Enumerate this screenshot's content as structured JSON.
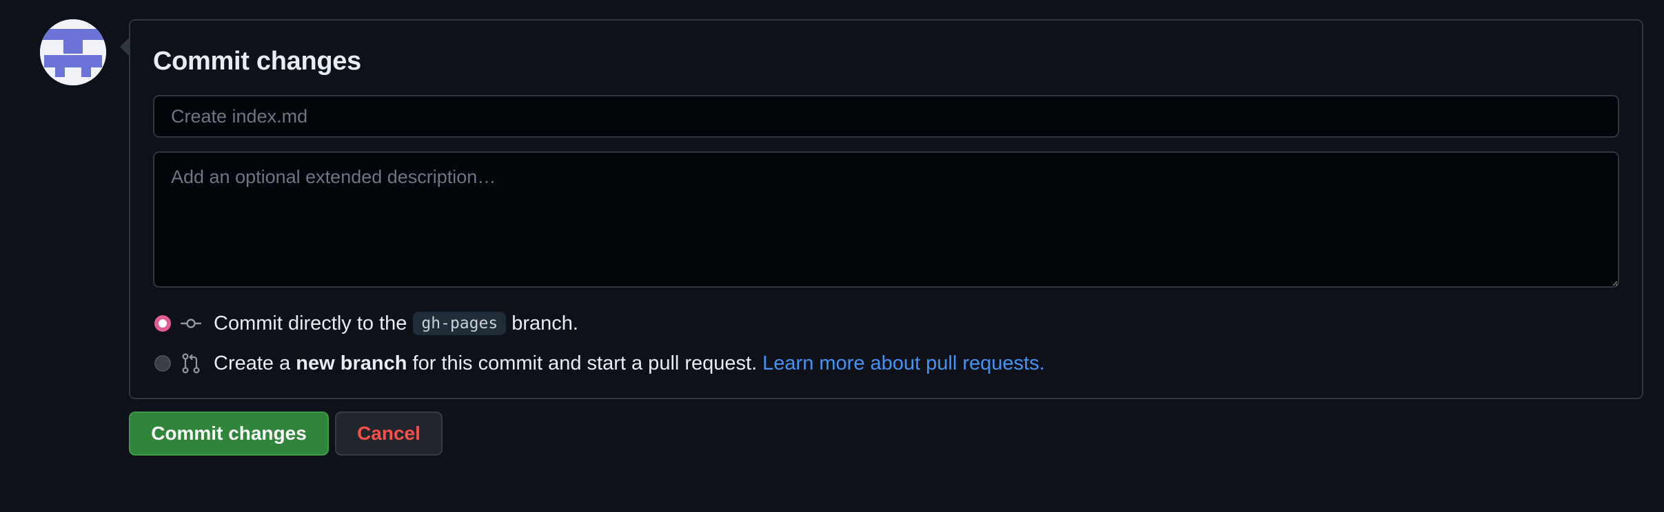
{
  "commit_form": {
    "title": "Commit changes",
    "summary_placeholder": "Create index.md",
    "description_placeholder": "Add an optional extended description…",
    "options": [
      {
        "checked": true,
        "icon": "git-commit-icon",
        "text_before": "Commit directly to the",
        "branch": "gh-pages",
        "text_after": "branch."
      },
      {
        "checked": false,
        "icon": "git-pull-request-icon",
        "text_before": "Create a",
        "bold_text": "new branch",
        "text_after": "for this commit and start a pull request.",
        "link_text": "Learn more about pull requests."
      }
    ]
  },
  "actions": {
    "commit_label": "Commit changes",
    "cancel_label": "Cancel"
  },
  "colors": {
    "background": "#0e1117",
    "primary_button": "#2f8539",
    "danger_text": "#f85149",
    "link": "#4493f8",
    "radio_checked": "#e05d95"
  }
}
